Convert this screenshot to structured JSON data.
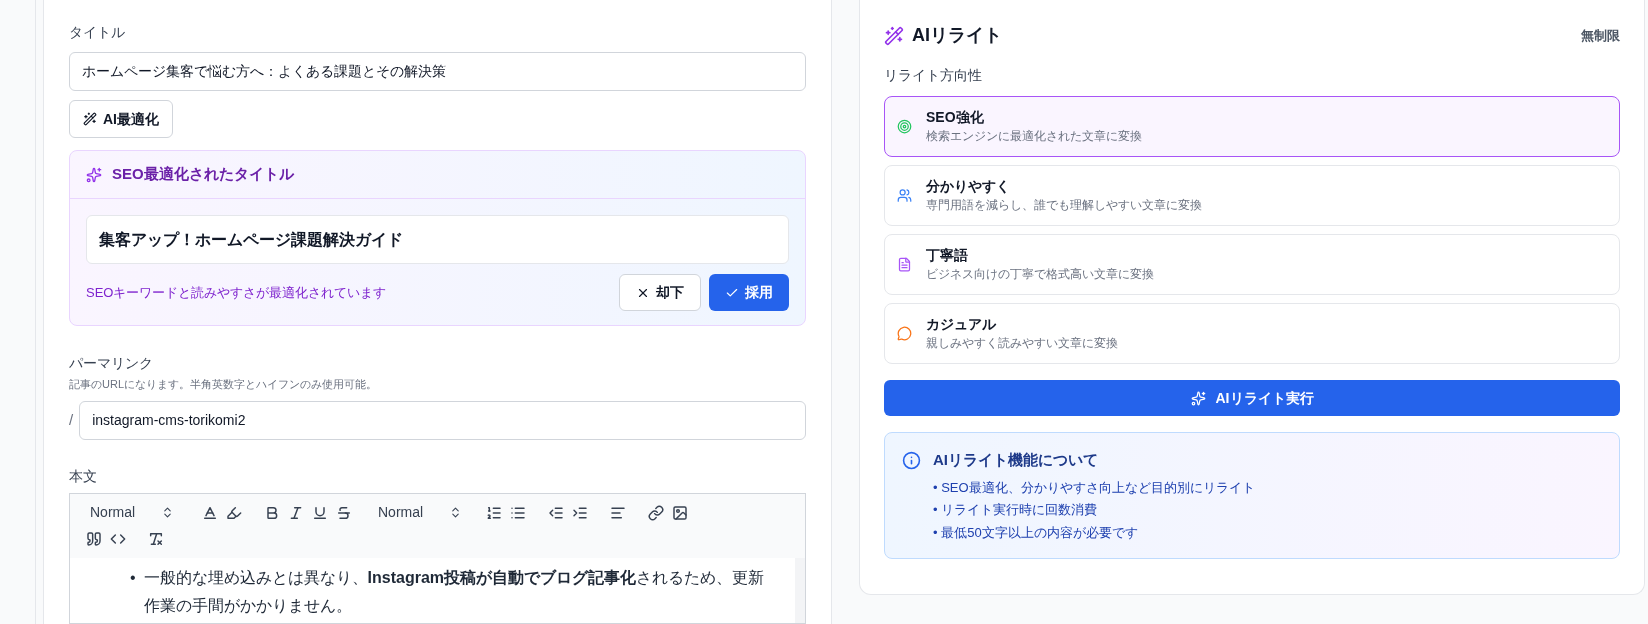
{
  "title_field": {
    "label": "タイトル",
    "value": "ホームページ集客で悩む方へ：よくある課題とその解決策"
  },
  "optimize_button": "AI最適化",
  "suggestion": {
    "heading": "SEO最適化されたタイトル",
    "title": "集客アップ！ホームページ課題解決ガイド",
    "note": "SEOキーワードと読みやすさが最適化されています",
    "buttons": [
      {
        "kind": "reject",
        "label": "却下"
      },
      {
        "kind": "accept",
        "label": "採用"
      }
    ]
  },
  "permalink": {
    "label": "パーマリンク",
    "hint": "記事のURLになります。半角英数字とハイフンのみ使用可能。",
    "prefix": "/",
    "value": "instagram-cms-torikomi2"
  },
  "body": {
    "label": "本文",
    "toolbar": {
      "header_select": "Normal",
      "size_select": "Normal"
    },
    "content": [
      {
        "marker": "•",
        "text": "一般的な埋め込みとは異なり、**Instagram投稿が自動でブログ記事化**されるため、更新作業の手間がかかりません。"
      }
    ]
  },
  "rewrite": {
    "title": "AIリライト",
    "quota": "無制限",
    "direction_label": "リライト方向性",
    "options": [
      {
        "kind": "seo",
        "title": "SEO強化",
        "description": "検索エンジンに最適化された文章に変換",
        "selected": true
      },
      {
        "kind": "clear",
        "title": "分かりやすく",
        "description": "専門用語を減らし、誰でも理解しやすい文章に変換",
        "selected": false
      },
      {
        "kind": "polite",
        "title": "丁寧語",
        "description": "ビジネス向けの丁寧で格式高い文章に変換",
        "selected": false
      },
      {
        "kind": "casual",
        "title": "カジュアル",
        "description": "親しみやすく読みやすい文章に変換",
        "selected": false
      }
    ],
    "run_button": "AIリライト実行",
    "info": {
      "title": "AIリライト機能について",
      "items": [
        "• SEO最適化、分かりやすさ向上など目的別にリライト",
        "• リライト実行時に回数消費",
        "• 最低50文字以上の内容が必要です"
      ]
    }
  }
}
